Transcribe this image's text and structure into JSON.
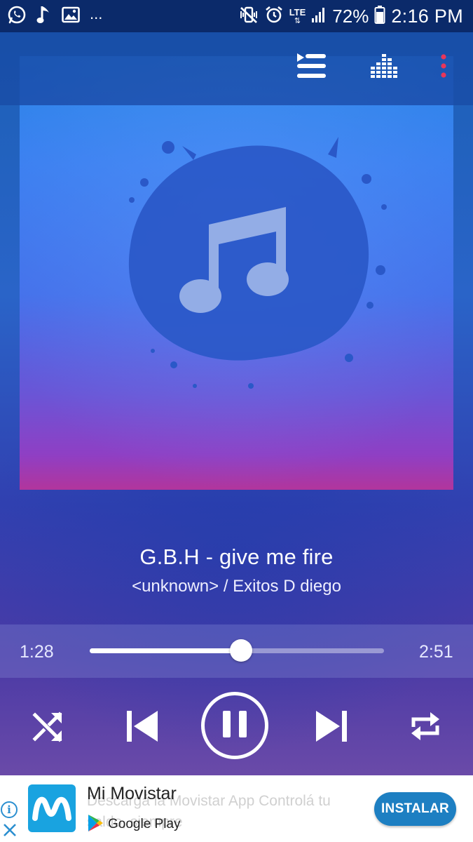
{
  "status_bar": {
    "left_icons": [
      "whatsapp-icon",
      "music-note-icon",
      "image-icon"
    ],
    "more_indicator": "...",
    "network_label": "LTE",
    "battery_percent": "72%",
    "time": "2:16 PM"
  },
  "toolbar": {
    "queue_icon": "playlist-icon",
    "equalizer_icon": "equalizer-icon",
    "menu_icon": "more-vertical-icon"
  },
  "track": {
    "title": "G.B.H - give me fire",
    "subtitle": "<unknown> / Exitos D  diego"
  },
  "playback": {
    "elapsed": "1:28",
    "duration": "2:51",
    "progress": 0.515
  },
  "controls": {
    "shuffle": "shuffle-icon",
    "previous": "skip-previous-icon",
    "play_pause": "pause-icon",
    "next": "skip-next-icon",
    "repeat": "repeat-icon"
  },
  "ad": {
    "title": "Mi Movistar",
    "description": "Descargá la Movistar App Controlá tu saldo, siempre",
    "store_label": "Google Play",
    "cta": "INSTALAR",
    "info_label": "i"
  },
  "colors": {
    "statusbar_bg": "#0b2a6a",
    "cta_bg": "#1d7fc2",
    "menu_dots": "#e8365a",
    "movistar_blue": "#19a3e0"
  }
}
